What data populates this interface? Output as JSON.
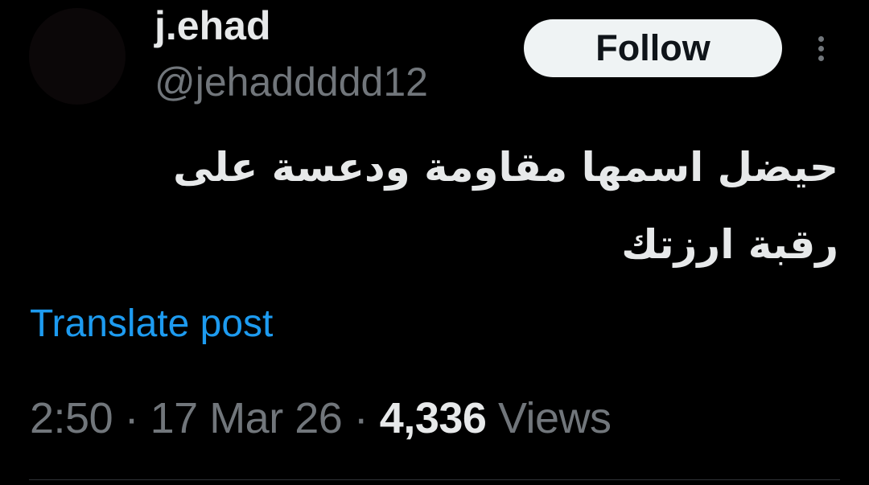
{
  "post": {
    "author": {
      "display_name": "j.ehad",
      "handle": "@jehaddddd12"
    },
    "follow_label": "Follow",
    "text": "حيضل اسمها مقاومة ودعسة على رقبة ارزتك",
    "translate_label": "Translate post",
    "meta": {
      "time": "2:50",
      "separator": "·",
      "date": "17 Mar 26",
      "views_count": "4,336",
      "views_label": "Views"
    }
  },
  "icons": {
    "more": "more-vertical-icon"
  },
  "colors": {
    "background": "#000000",
    "primary_text": "#e7e9ea",
    "secondary_text": "#71767b",
    "accent": "#1d9bf0",
    "follow_button_bg": "#eff3f4"
  }
}
